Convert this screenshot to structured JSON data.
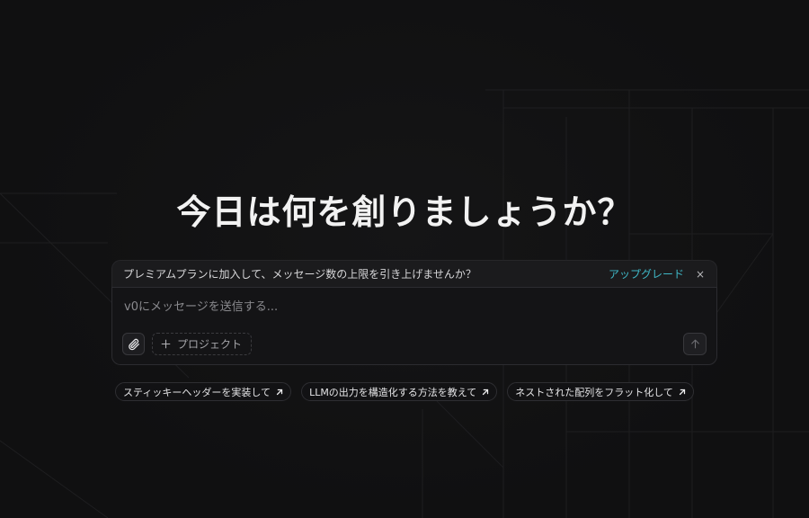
{
  "headline": "今日は何を創りましょうか？",
  "banner": {
    "text": "プレミアムプランに加入して、メッセージ数の上限を引き上げませんか？",
    "upgrade_label": "アップグレード",
    "close_glyph": "×"
  },
  "composer": {
    "placeholder": "v0にメッセージを送信する...",
    "value": "",
    "project_label": "プロジェクト"
  },
  "suggestions": [
    {
      "label": "スティッキーヘッダーを実装して"
    },
    {
      "label": "LLMの出力を構造化する方法を教えて"
    },
    {
      "label": "ネストされた配列をフラット化して"
    }
  ],
  "icons": {
    "attach": "paperclip-icon",
    "project": "plus-icon",
    "send": "arrow-up-icon",
    "suggestion": "arrow-up-right-icon"
  },
  "colors": {
    "background": "#111112",
    "accent": "#3fb7c6",
    "text": "#ededed"
  }
}
